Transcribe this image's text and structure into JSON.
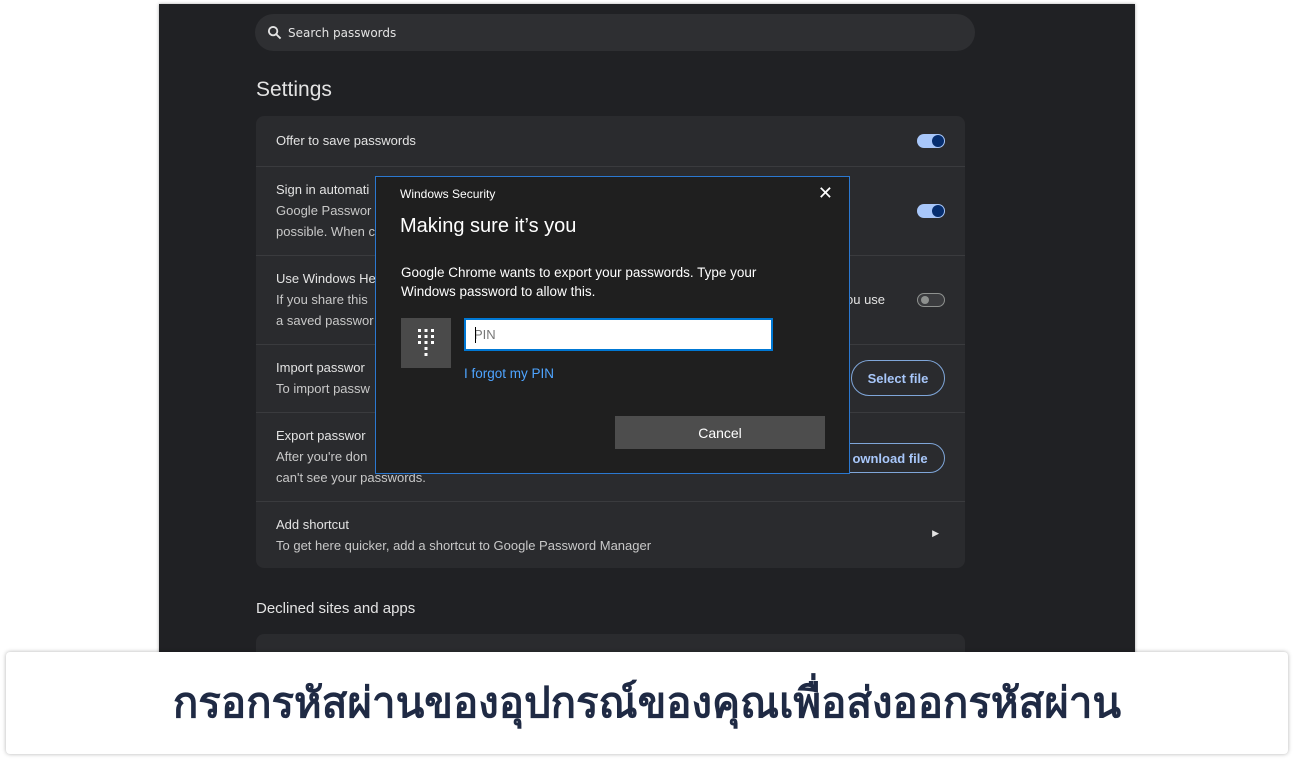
{
  "search": {
    "placeholder": "Search passwords"
  },
  "settings": {
    "title": "Settings",
    "rows": [
      {
        "title": "Offer to save passwords",
        "toggle": "on"
      },
      {
        "title": "Sign in automati",
        "line2": "Google Passwor",
        "line3": "possible. When c",
        "toggle": "on"
      },
      {
        "title": "Use Windows He",
        "line2": "If you share this",
        "line3": "a saved passwor",
        "right_text": "ou use",
        "toggle": "off"
      },
      {
        "title": "Import passwor",
        "line2": "To import passw",
        "button": "Select file"
      },
      {
        "title": "Export passwor",
        "line2": "After you're don",
        "line3": "can't see your passwords.",
        "button": "ownload file"
      },
      {
        "title": "Add shortcut",
        "line2": "To get here quicker, add a shortcut to Google Password Manager"
      }
    ]
  },
  "declined": {
    "title": "Declined sites and apps"
  },
  "dialog": {
    "app_name": "Windows Security",
    "title": "Making sure it’s you",
    "message": "Google Chrome wants to export your passwords. Type your Windows password to allow this.",
    "pin_placeholder": "PIN",
    "forgot_link": "I forgot my PIN",
    "cancel": "Cancel",
    "border_color": "#2b78d0"
  },
  "caption": {
    "text": "กรอกรหัสผ่านของอุปกรณ์ของคุณเพื่อส่งออกรหัสผ่าน"
  },
  "colors": {
    "accent": "#a8c7fa",
    "background": "#202124",
    "card": "#2a2b2e"
  }
}
